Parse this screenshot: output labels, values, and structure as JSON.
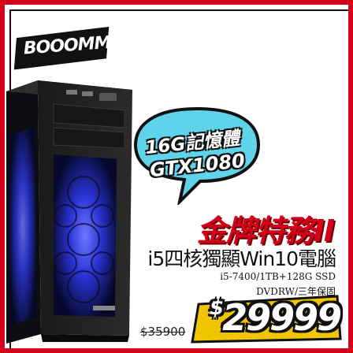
{
  "badge": {
    "text": "BOOOMM!!"
  },
  "bubble": {
    "line1": "16G記憶體",
    "line2": "GTX1080"
  },
  "product": {
    "headline": "金牌特務II",
    "subline": "i5四核獨顯Win10電腦",
    "spec_line1": "i5-7400/1TB+128G SSD",
    "spec_line2": "DVDRW/三年保固"
  },
  "pricing": {
    "original": "$35900",
    "currency": "$",
    "sale": "29999"
  },
  "colors": {
    "frame": "#d4001a",
    "fan_glow": "#3a46ff",
    "headline": "#d4001a",
    "price_box": "#f0c400"
  }
}
